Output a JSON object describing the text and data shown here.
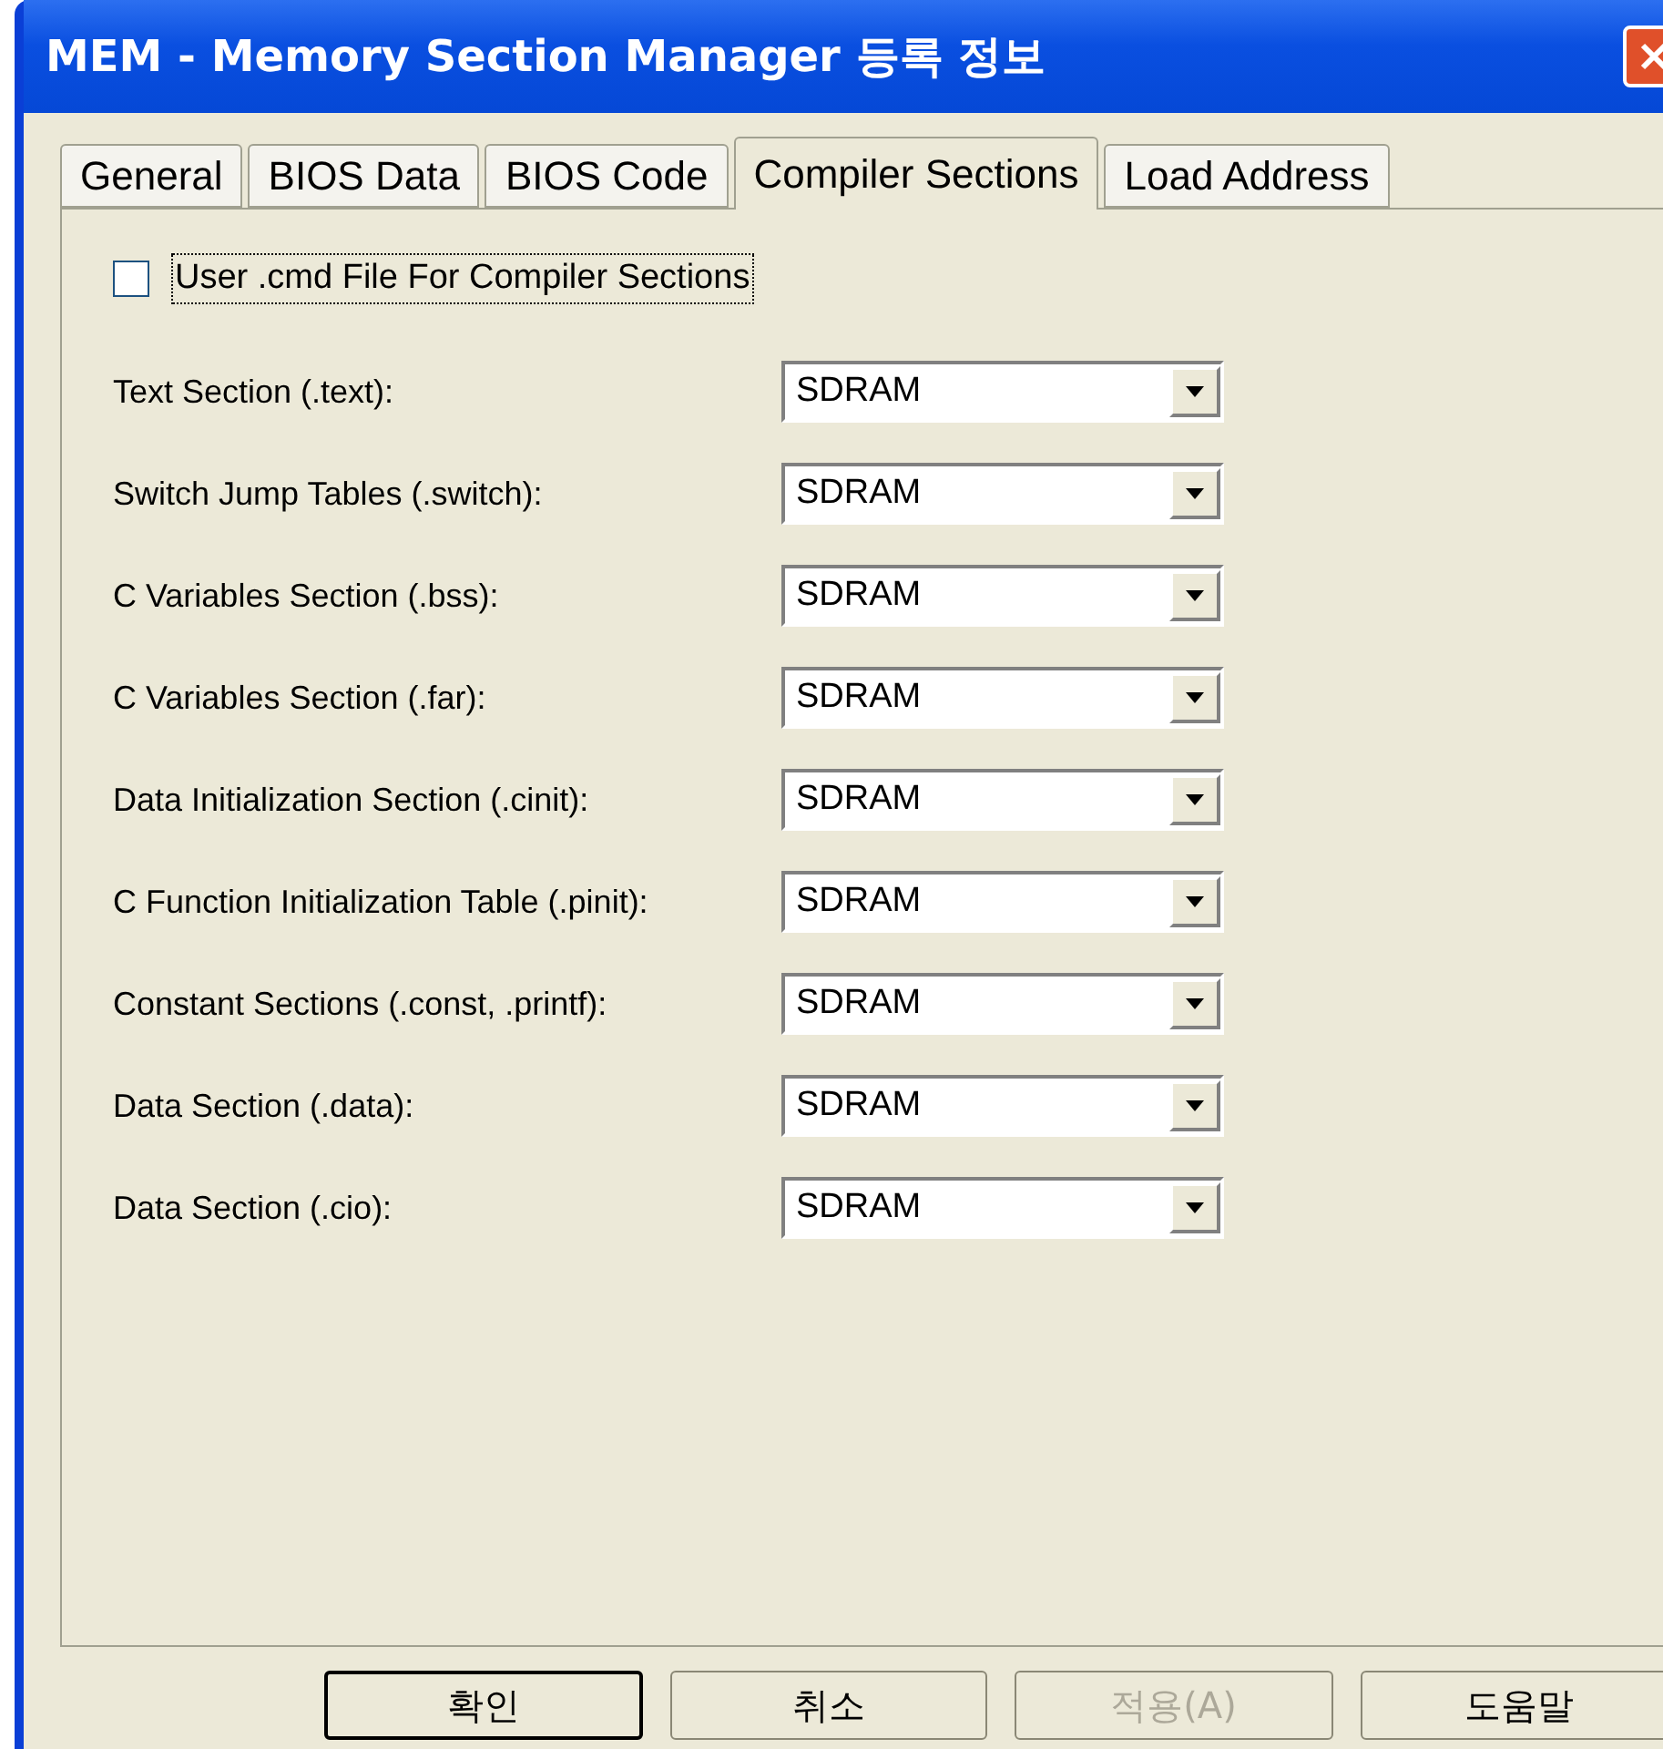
{
  "window": {
    "title": "MEM - Memory Section Manager 등록 정보"
  },
  "tabs": [
    {
      "label": "General",
      "selected": false
    },
    {
      "label": "BIOS Data",
      "selected": false
    },
    {
      "label": "BIOS Code",
      "selected": false
    },
    {
      "label": "Compiler Sections",
      "selected": true
    },
    {
      "label": "Load Address",
      "selected": false
    }
  ],
  "user_cmd": {
    "label": "User .cmd File For Compiler Sections",
    "checked": false
  },
  "sections": [
    {
      "label": "Text Section (.text):",
      "value": "SDRAM"
    },
    {
      "label": "Switch Jump Tables (.switch):",
      "value": "SDRAM"
    },
    {
      "label": "C Variables Section (.bss):",
      "value": "SDRAM"
    },
    {
      "label": "C Variables Section (.far):",
      "value": "SDRAM"
    },
    {
      "label": "Data Initialization Section (.cinit):",
      "value": "SDRAM"
    },
    {
      "label": "C Function Initialization Table (.pinit):",
      "value": "SDRAM"
    },
    {
      "label": "Constant Sections (.const, .printf):",
      "value": "SDRAM"
    },
    {
      "label": "Data Section (.data):",
      "value": "SDRAM"
    },
    {
      "label": "Data Section (.cio):",
      "value": "SDRAM"
    }
  ],
  "buttons": [
    {
      "label": "확인",
      "disabled": false,
      "default": true
    },
    {
      "label": "취소",
      "disabled": false,
      "default": false
    },
    {
      "label": "적용(A)",
      "disabled": true,
      "default": false
    },
    {
      "label": "도움말",
      "disabled": false,
      "default": false
    }
  ]
}
